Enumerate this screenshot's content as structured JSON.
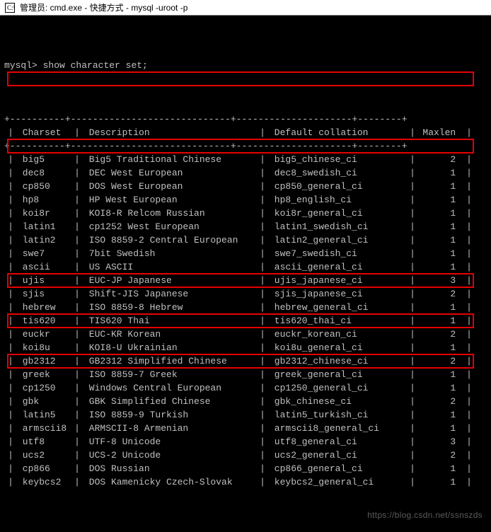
{
  "titlebar": {
    "text": "管理员: cmd.exe - 快捷方式 - mysql  -uroot -p"
  },
  "prompt": "mysql>",
  "command": "show character set;",
  "headers": {
    "charset": "Charset",
    "description": "Description",
    "collation": "Default collation",
    "maxlen": "Maxlen"
  },
  "rows": [
    {
      "charset": "big5",
      "description": "Big5 Traditional Chinese",
      "collation": "big5_chinese_ci",
      "maxlen": "2",
      "highlight": true
    },
    {
      "charset": "dec8",
      "description": "DEC West European",
      "collation": "dec8_swedish_ci",
      "maxlen": "1"
    },
    {
      "charset": "cp850",
      "description": "DOS West European",
      "collation": "cp850_general_ci",
      "maxlen": "1"
    },
    {
      "charset": "hp8",
      "description": "HP West European",
      "collation": "hp8_english_ci",
      "maxlen": "1"
    },
    {
      "charset": "koi8r",
      "description": "KOI8-R Relcom Russian",
      "collation": "koi8r_general_ci",
      "maxlen": "1"
    },
    {
      "charset": "latin1",
      "description": "cp1252 West European",
      "collation": "latin1_swedish_ci",
      "maxlen": "1",
      "highlight": true
    },
    {
      "charset": "latin2",
      "description": "ISO 8859-2 Central European",
      "collation": "latin2_general_ci",
      "maxlen": "1"
    },
    {
      "charset": "swe7",
      "description": "7bit Swedish",
      "collation": "swe7_swedish_ci",
      "maxlen": "1"
    },
    {
      "charset": "ascii",
      "description": "US ASCII",
      "collation": "ascii_general_ci",
      "maxlen": "1"
    },
    {
      "charset": "ujis",
      "description": "EUC-JP Japanese",
      "collation": "ujis_japanese_ci",
      "maxlen": "3"
    },
    {
      "charset": "sjis",
      "description": "Shift-JIS Japanese",
      "collation": "sjis_japanese_ci",
      "maxlen": "2"
    },
    {
      "charset": "hebrew",
      "description": "ISO 8859-8 Hebrew",
      "collation": "hebrew_general_ci",
      "maxlen": "1"
    },
    {
      "charset": "tis620",
      "description": "TIS620 Thai",
      "collation": "tis620_thai_ci",
      "maxlen": "1"
    },
    {
      "charset": "euckr",
      "description": "EUC-KR Korean",
      "collation": "euckr_korean_ci",
      "maxlen": "2"
    },
    {
      "charset": "koi8u",
      "description": "KOI8-U Ukrainian",
      "collation": "koi8u_general_ci",
      "maxlen": "1"
    },
    {
      "charset": "gb2312",
      "description": "GB2312 Simplified Chinese",
      "collation": "gb2312_chinese_ci",
      "maxlen": "2",
      "highlight": true
    },
    {
      "charset": "greek",
      "description": "ISO 8859-7 Greek",
      "collation": "greek_general_ci",
      "maxlen": "1"
    },
    {
      "charset": "cp1250",
      "description": "Windows Central European",
      "collation": "cp1250_general_ci",
      "maxlen": "1"
    },
    {
      "charset": "gbk",
      "description": "GBK Simplified Chinese",
      "collation": "gbk_chinese_ci",
      "maxlen": "2",
      "highlight": true
    },
    {
      "charset": "latin5",
      "description": "ISO 8859-9 Turkish",
      "collation": "latin5_turkish_ci",
      "maxlen": "1"
    },
    {
      "charset": "armscii8",
      "description": "ARMSCII-8 Armenian",
      "collation": "armscii8_general_ci",
      "maxlen": "1"
    },
    {
      "charset": "utf8",
      "description": "UTF-8 Unicode",
      "collation": "utf8_general_ci",
      "maxlen": "3",
      "highlight": true
    },
    {
      "charset": "ucs2",
      "description": "UCS-2 Unicode",
      "collation": "ucs2_general_ci",
      "maxlen": "2"
    },
    {
      "charset": "cp866",
      "description": "DOS Russian",
      "collation": "cp866_general_ci",
      "maxlen": "1"
    },
    {
      "charset": "keybcs2",
      "description": "DOS Kamenicky Czech-Slovak",
      "collation": "keybcs2_general_ci",
      "maxlen": "1"
    }
  ],
  "watermark": "https://blog.csdn.net/ssnszds"
}
